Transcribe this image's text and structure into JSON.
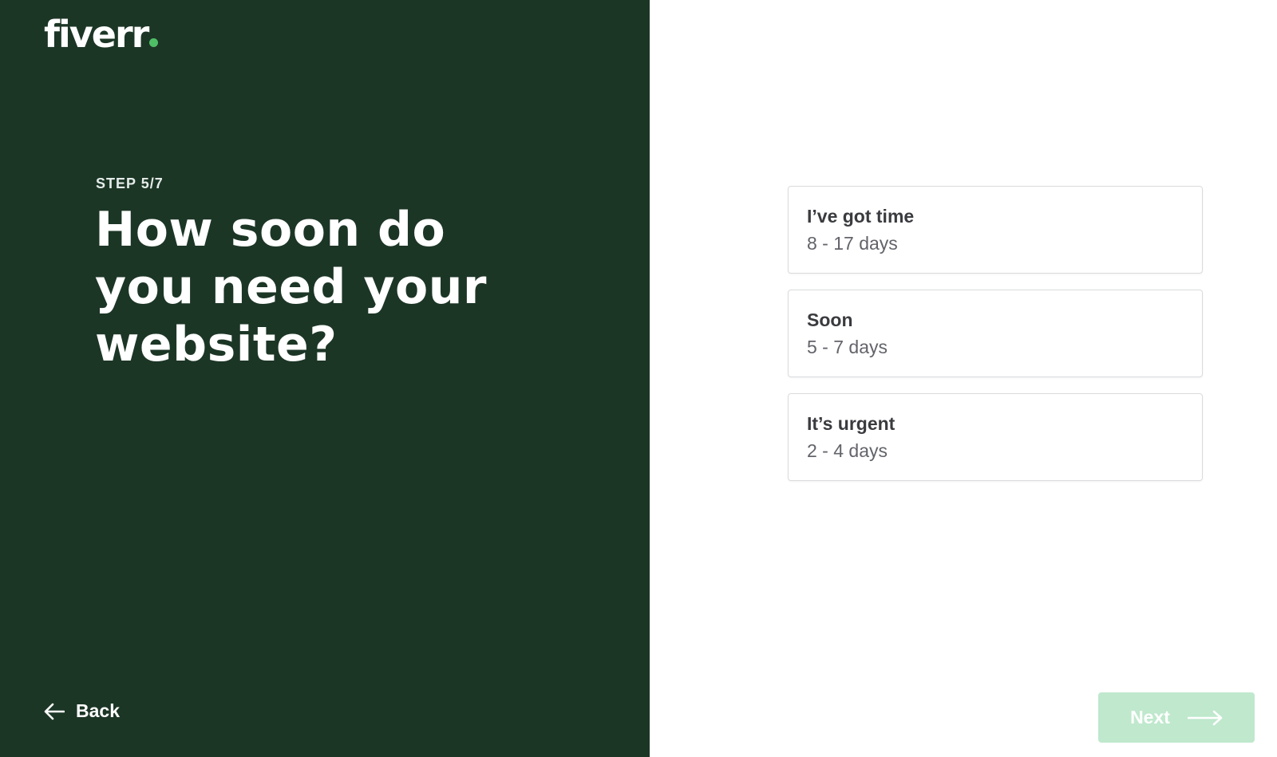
{
  "brand": {
    "logo_text": "fiverr",
    "accent_color": "#4fbf67",
    "panel_color": "#1c3626"
  },
  "header": {
    "step": "STEP 5/7",
    "question": "How soon do you need your website?"
  },
  "options": [
    {
      "title": "I’ve got time",
      "subtitle": "8 - 17 days"
    },
    {
      "title": "Soon",
      "subtitle": "5 - 7 days"
    },
    {
      "title": "It’s urgent",
      "subtitle": "2 - 4 days"
    }
  ],
  "navigation": {
    "back_label": "Back",
    "back_icon": "arrow-left-icon",
    "next_label": "Next",
    "next_icon": "arrow-right-icon",
    "next_color": "#bfe8cd"
  }
}
